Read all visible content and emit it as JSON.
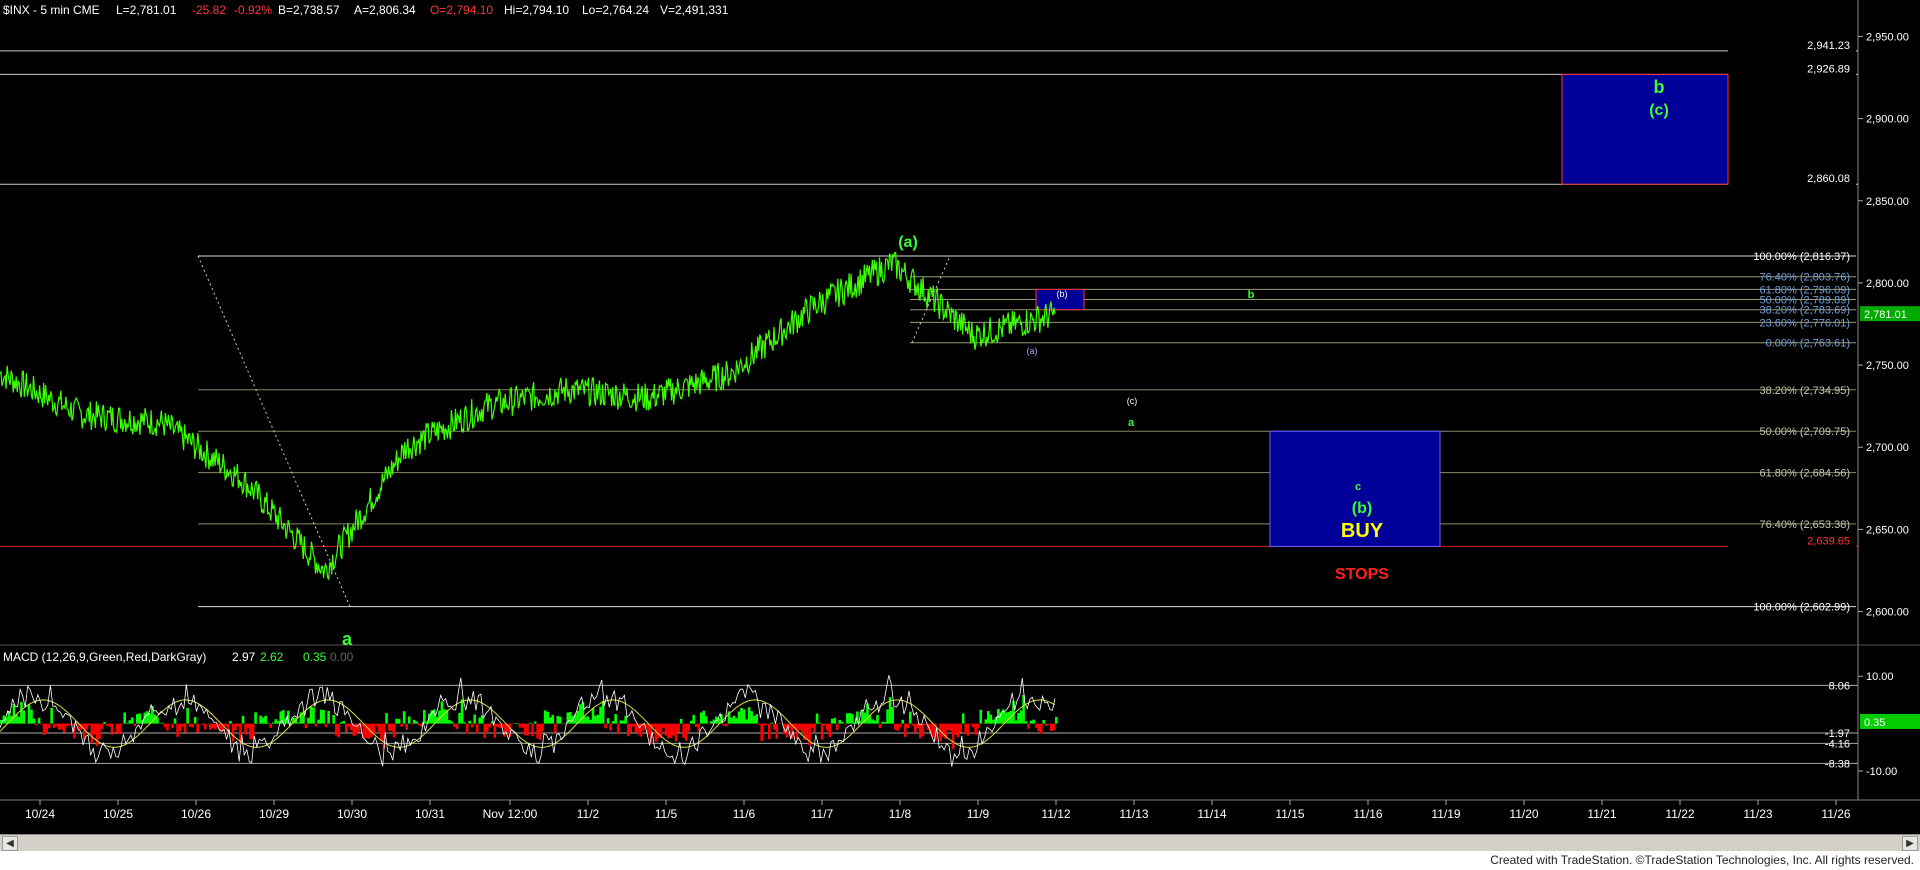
{
  "header": {
    "symbol": "$INX - 5 min  CME",
    "last": "L=2,781.01",
    "change": "-25.82",
    "change_pct": "-0.92%",
    "bid": "B=2,738.57",
    "ask": "A=2,806.34",
    "open": "O=2,794.10",
    "high": "Hi=2,794.10",
    "low": "Lo=2,764.24",
    "volume": "V=2,491,331"
  },
  "colors": {
    "background": "#000000",
    "price": "#3cff00",
    "macd_line": "#00ff00",
    "signal_line": "#ff3333",
    "hist_pos": "#00ff00",
    "hist_neg": "#ff0000",
    "box": "#000099",
    "box_border": "#ff3333",
    "fib_text": "#c8c8aa",
    "wave_label": "#33ff33",
    "buy": "#ffff00",
    "stops": "#ff2020",
    "axis_text": "#ffffff",
    "footer_bg": "#ffffff"
  },
  "price_panel": {
    "y_ticks": [
      "2,950.00",
      "2,900.00",
      "2,850.00",
      "2,800.00",
      "2,750.00",
      "2,700.00",
      "2,650.00",
      "2,600.00"
    ],
    "current_price_tag": "2,781.01",
    "price_levels": [
      {
        "label": "2,941.23",
        "value": 2941.23,
        "color": "#ffffff",
        "lineColor": "#cccccc"
      },
      {
        "label": "2,926.89",
        "value": 2926.89,
        "color": "#ffffff",
        "lineColor": "#cccccc"
      },
      {
        "label": "2,860.08",
        "value": 2860.08,
        "color": "#ffffff",
        "lineColor": "#cccccc"
      },
      {
        "label": "2,639.65",
        "value": 2639.65,
        "color": "#ff3333",
        "lineColor": "#cc2222"
      }
    ],
    "fib_down": [
      {
        "label": "100.00% (2,816.37)",
        "value": 2816.37
      },
      {
        "label": "76.40% (2,803.76)",
        "value": 2803.76
      },
      {
        "label": "61.80% (2,796.09)",
        "value": 2796.09
      },
      {
        "label": "50.00% (2,789.89)",
        "value": 2789.89
      },
      {
        "label": "38.20% (2,783.69)",
        "value": 2783.69
      },
      {
        "label": "23.60% (2,776.01)",
        "value": 2776.01
      },
      {
        "label": "0.00% (2,763.61)",
        "value": 2763.61
      }
    ],
    "fib_up": [
      {
        "label": "38.20% (2,734.95)",
        "value": 2734.95
      },
      {
        "label": "50.00% (2,709.75)",
        "value": 2709.75
      },
      {
        "label": "61.80% (2,684.56)",
        "value": 2684.56
      },
      {
        "label": "76.40% (2,653.38)",
        "value": 2653.38
      },
      {
        "label": "100.00% (2,602.99)",
        "value": 2602.99
      }
    ],
    "wave_labels": {
      "a_main": "a",
      "a_paren": "(a)",
      "b_small_paren": "(b)",
      "a_small_paren": "(a)",
      "c_small_paren": "(c)",
      "a_small": "a",
      "b_small": "b",
      "c_small": "c",
      "b_box": "(b)",
      "buy": "BUY",
      "stops": "STOPS",
      "b_big": "b",
      "c_big": "(c)"
    }
  },
  "macd_panel": {
    "title": "MACD (12,26,9,Green,Red,DarkGray)",
    "macd_value": "2.97",
    "signal_value": "2.62",
    "hist_value": "0.35",
    "zero_value": "0.00",
    "y_ticks": [
      "10.00",
      "-10.00"
    ],
    "levels": [
      {
        "label": "8.06",
        "value": 8.06
      },
      {
        "label": "-1.97",
        "value": -1.97
      },
      {
        "label": "-4.16",
        "value": -4.16
      },
      {
        "label": "-8.38",
        "value": -8.38
      }
    ],
    "current_tag": "0.35"
  },
  "x_axis": {
    "labels": [
      "10/24",
      "10/25",
      "10/26",
      "10/29",
      "10/30",
      "10/31",
      "Nov 12:00",
      "11/2",
      "11/5",
      "11/6",
      "11/7",
      "11/8",
      "11/9",
      "11/12",
      "11/13",
      "11/14",
      "11/15",
      "11/16",
      "11/19",
      "11/20",
      "11/21",
      "11/22",
      "11/23",
      "11/26"
    ]
  },
  "footer": {
    "text": "Created with TradeStation. ©TradeStation Technologies, Inc. All rights reserved."
  },
  "chart_data": {
    "type": "line",
    "title": "$INX - 5 min",
    "x": [
      "10/24",
      "10/25",
      "10/26",
      "10/29",
      "10/30",
      "10/31",
      "Nov",
      "11/2",
      "11/5",
      "11/6",
      "11/7",
      "11/8",
      "11/9",
      "11/12"
    ],
    "series": [
      {
        "values": [
          2745,
          2720,
          2715,
          2680,
          2625,
          2700,
          2725,
          2735,
          2730,
          2745,
          2785,
          2812,
          2768,
          2781
        ]
      }
    ],
    "ylim": [
      2590,
      2960
    ],
    "grid": false
  }
}
